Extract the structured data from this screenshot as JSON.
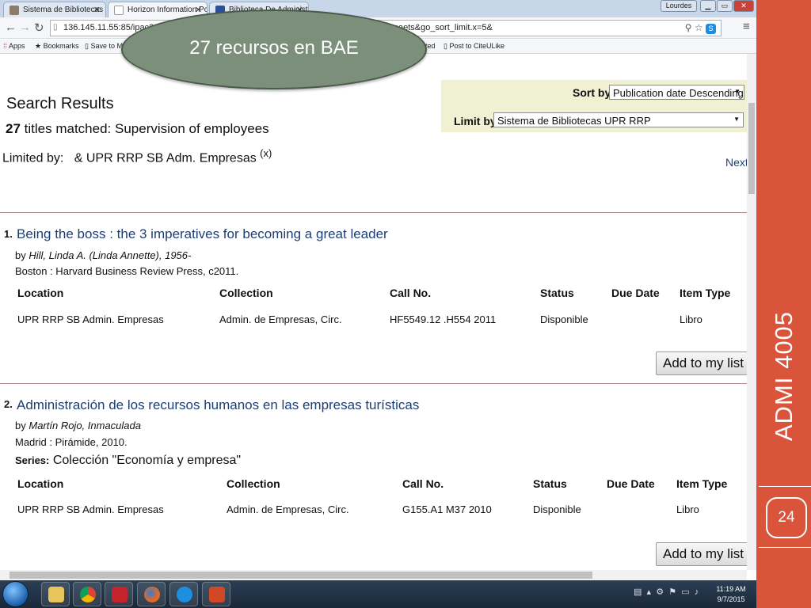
{
  "browser": {
    "tabs": [
      {
        "label": "Sistema de Bibliotecas"
      },
      {
        "label": "Horizon Information Porta"
      },
      {
        "label": "Biblioteca De Administrac"
      }
    ],
    "window_user": "Lourdes",
    "url": "136.145.11.55:85/ipac20/ipac.jsp?...f+or+CO01+%3D+co_saerv+or+CO01+%3D+co_saets&go_sort_limit.x=5&",
    "bookmarks": [
      {
        "label": "Apps"
      },
      {
        "label": "Bookmarks"
      },
      {
        "label": "Save to M"
      },
      {
        "label": "ted"
      },
      {
        "label": "Post to CiteULike"
      }
    ]
  },
  "callout": {
    "text": "27 recursos en BAE"
  },
  "sort": {
    "sort_label": "Sort by:",
    "sort_value": "Publication date Descending",
    "limit_label": "Limit by:",
    "limit_value": "Sistema de Bibliotecas UPR RRP"
  },
  "results": {
    "heading": "Search Results",
    "count": "27",
    "matched_text": "titles matched:",
    "query": "Supervision of employees",
    "limited_by_label": "Limited by:",
    "limited_by_value": "& UPR RRP SB Adm. Empresas",
    "remove_limit": "(x)",
    "next": "Next"
  },
  "columns": {
    "location": "Location",
    "collection": "Collection",
    "call_no": "Call No.",
    "status": "Status",
    "due_date": "Due Date",
    "item_type": "Item Type"
  },
  "records": [
    {
      "num": "1.",
      "title": "Being the boss : the 3 imperatives for becoming a great leader",
      "by": "by",
      "author": "Hill, Linda A. (Linda Annette), 1956-",
      "publisher": "Boston : Harvard Business Review Press, c2011.",
      "series_label": "",
      "series_value": "",
      "location": "UPR RRP SB Admin. Empresas",
      "collection": "Admin. de Empresas, Circ.",
      "call_no": "HF5549.12 .H554 2011",
      "status": "Disponible",
      "due_date": "",
      "item_type": "Libro",
      "add_label": "Add to my list"
    },
    {
      "num": "2.",
      "title": "Administración de los recursos humanos en las empresas turísticas",
      "by": "by",
      "author": "Martín Rojo, Inmaculada",
      "publisher": "Madrid : Pirámide, 2010.",
      "series_label": "Series:",
      "series_value": "Colección \"Economía y empresa\"",
      "location": "UPR RRP SB Admin. Empresas",
      "collection": "Admin. de Empresas, Circ.",
      "call_no": "G155.A1 M37 2010",
      "status": "Disponible",
      "due_date": "",
      "item_type": "Libro",
      "add_label": "Add to my list"
    }
  ],
  "taskbar": {
    "time": "11:19 AM",
    "date": "9/7/2015"
  },
  "slide": {
    "title": "ADMI 4005",
    "page": "24"
  },
  "colors": {
    "accent": "#d9543a",
    "callout": "#7b8f7a",
    "link": "#1d3e73",
    "sort_bg": "#f0f0d2"
  }
}
